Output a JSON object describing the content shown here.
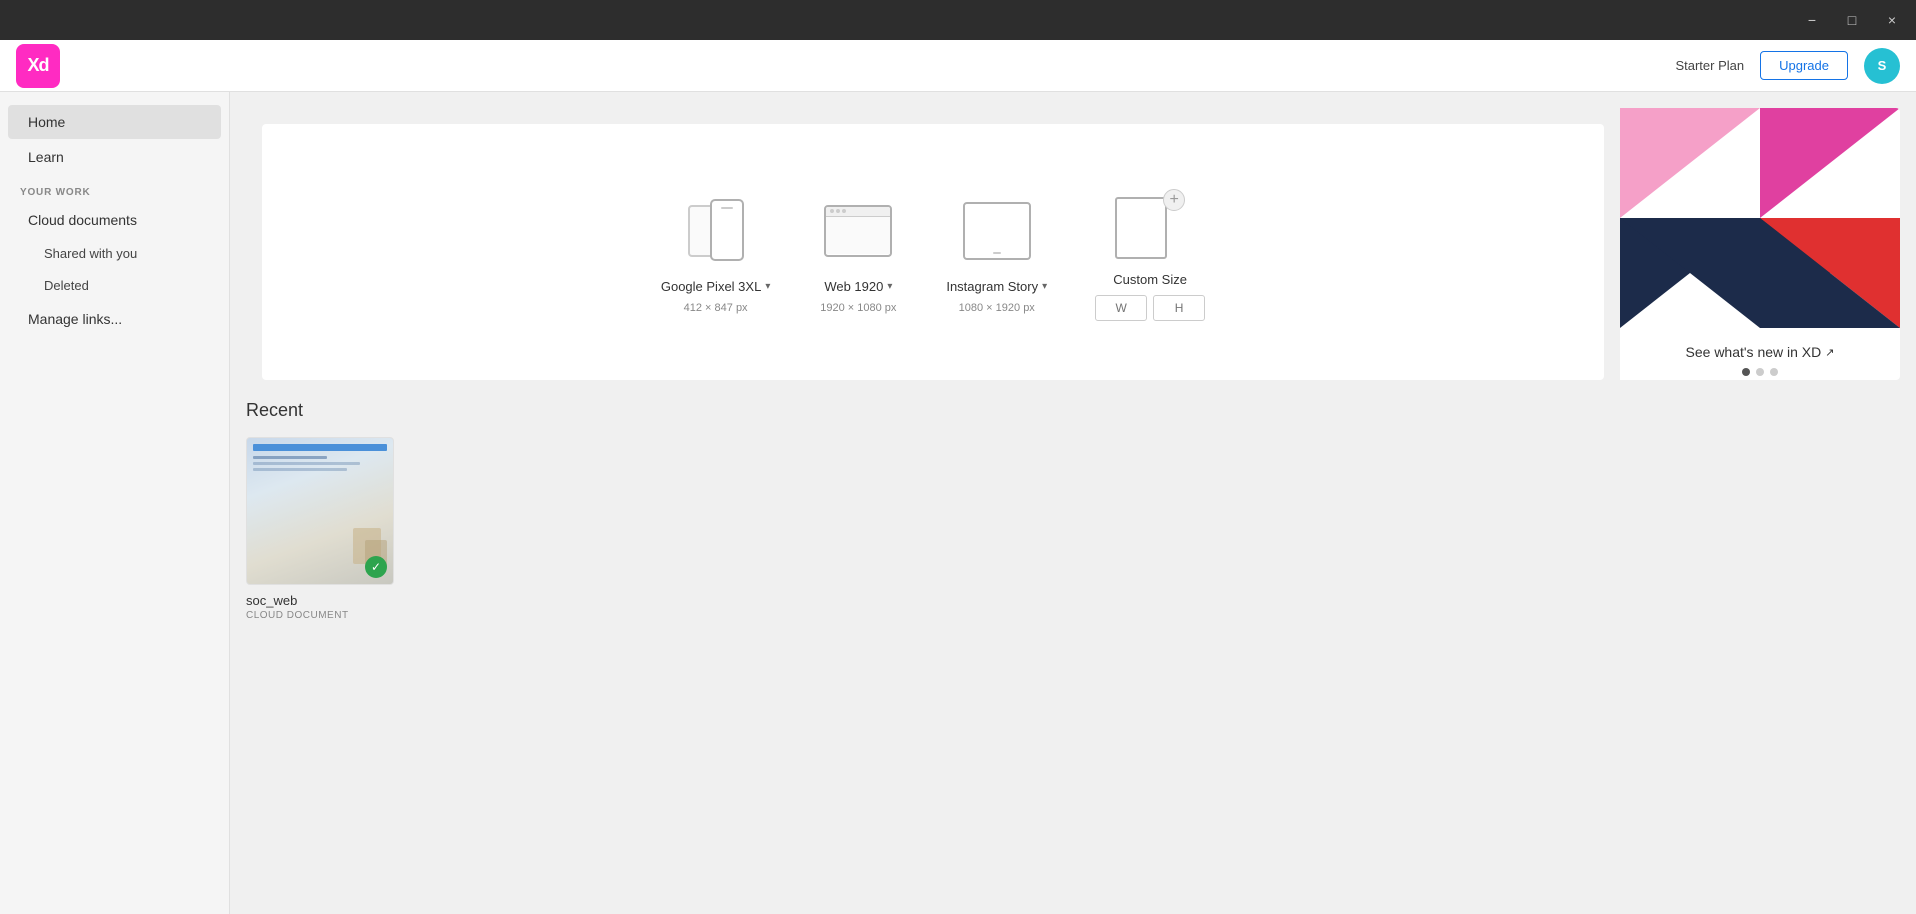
{
  "titleBar": {
    "minimizeLabel": "−",
    "maximizeLabel": "□",
    "closeLabel": "×"
  },
  "header": {
    "logoText": "Xd",
    "starterPlanLabel": "Starter Plan",
    "upgradeLabel": "Upgrade",
    "avatarInitials": "S"
  },
  "sidebar": {
    "homeLabel": "Home",
    "learnLabel": "Learn",
    "yourWorkLabel": "YOUR WORK",
    "cloudDocsLabel": "Cloud documents",
    "sharedWithYouLabel": "Shared with you",
    "deletedLabel": "Deleted",
    "manageLinksLabel": "Manage links..."
  },
  "newDocument": {
    "templates": [
      {
        "id": "google-pixel",
        "label": "Google Pixel 3XL",
        "dimensions": "412 × 847 px",
        "hasDropdown": true
      },
      {
        "id": "web-1920",
        "label": "Web 1920",
        "dimensions": "1920 × 1080 px",
        "hasDropdown": true
      },
      {
        "id": "instagram-story",
        "label": "Instagram Story",
        "dimensions": "1080 × 1920 px",
        "hasDropdown": true
      },
      {
        "id": "custom-size",
        "label": "Custom Size",
        "dimensions": "",
        "hasDropdown": false
      }
    ],
    "customWidthPlaceholder": "W",
    "customHeightPlaceholder": "H"
  },
  "promo": {
    "whatsNewLabel": "See what's new in XD",
    "dots": [
      {
        "active": true
      },
      {
        "active": false
      },
      {
        "active": false
      }
    ]
  },
  "recent": {
    "title": "Recent",
    "files": [
      {
        "name": "soc_web",
        "type": "CLOUD DOCUMENT",
        "synced": true
      }
    ]
  }
}
